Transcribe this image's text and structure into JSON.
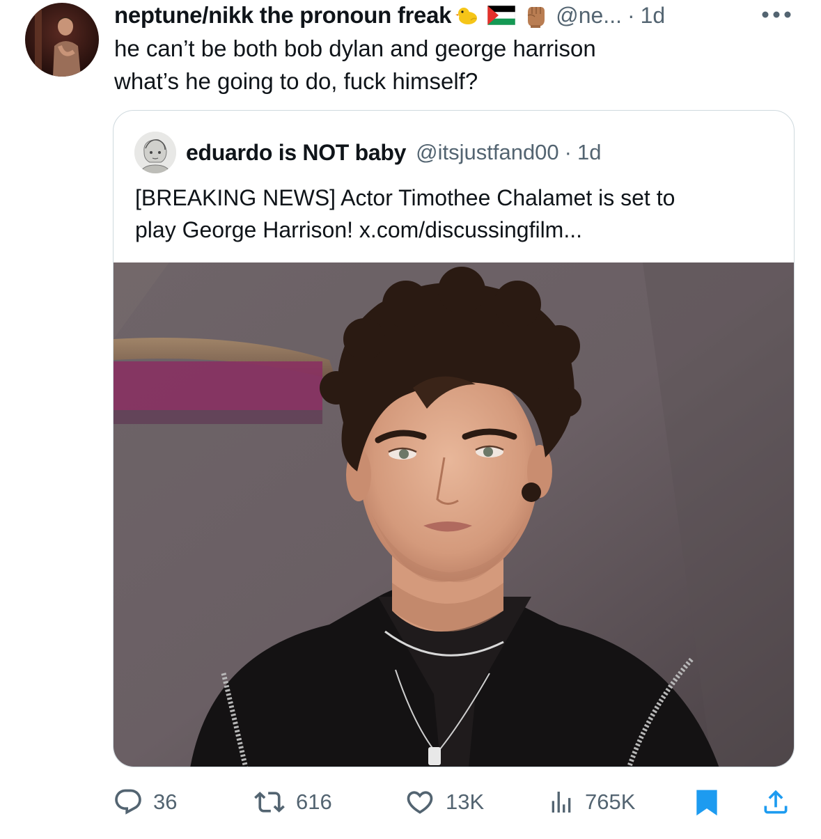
{
  "tweet": {
    "display_name": "neptune/nikk the pronoun freak",
    "emojis": [
      "duck-icon",
      "palestine-flag-icon",
      "raised-fist-icon"
    ],
    "handle": "@ne...",
    "separator": "·",
    "time": "1d",
    "text_lines": [
      "he can’t be both bob dylan and george harrison",
      "what’s he going to do, fuck himself?"
    ]
  },
  "quote": {
    "display_name": "eduardo is NOT baby",
    "handle": "@itsjustfand00",
    "separator": "·",
    "time": "1d",
    "text_lines": [
      "[BREAKING NEWS] Actor Timothee Chalamet is set to",
      "play George Harrison! x.com/discussingfilm..."
    ]
  },
  "actions": {
    "replies": "36",
    "retweets": "616",
    "likes": "13K",
    "views": "765K"
  },
  "colors": {
    "text": "#0f1419",
    "secondary": "#536471",
    "accent": "#1d9bf0",
    "border": "#cfd9de"
  }
}
